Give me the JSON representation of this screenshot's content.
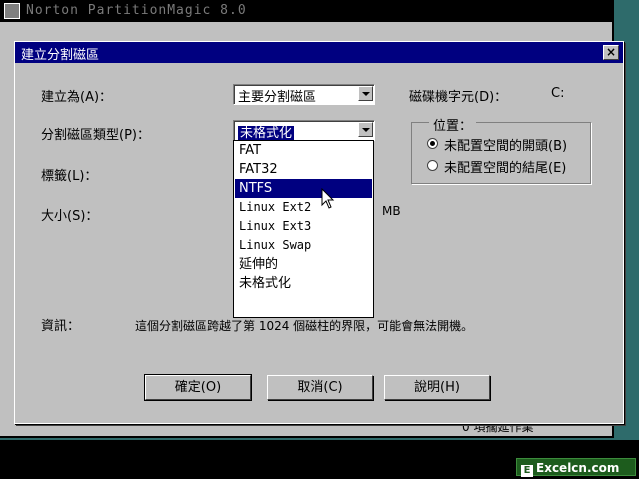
{
  "background_window": {
    "title": "Norton PartitionMagic 8.0",
    "status_text": "0 項擱延作業"
  },
  "dialog": {
    "title": "建立分割磁區",
    "close_label": "×"
  },
  "form": {
    "create_as_label": "建立為(A)：",
    "create_as_value": "主要分割磁區",
    "drive_letter_label": "磁碟機字元(D)：",
    "drive_letter_value": "C:",
    "fs_type_label": "分割磁區類型(P)：",
    "fs_type_value": "未格式化",
    "label_label": "標籤(L)：",
    "size_label": "大小(S)：",
    "size_unit": "MB"
  },
  "position_group": {
    "legend": "位置：",
    "options": [
      {
        "label": "未配置空間的開頭(B)",
        "checked": true
      },
      {
        "label": "未配置空間的結尾(E)",
        "checked": false
      }
    ]
  },
  "dropdown": {
    "items": [
      "FAT",
      "FAT32",
      "NTFS",
      "Linux Ext2",
      "Linux Ext3",
      "Linux Swap",
      "延伸的",
      "未格式化"
    ],
    "highlighted": "NTFS"
  },
  "info": {
    "label": "資訊：",
    "text": "這個分割磁區跨越了第 1024 個磁柱的界限，可能會無法開機。"
  },
  "buttons": {
    "ok": "確定(O)",
    "cancel": "取消(C)",
    "help": "說明(H)"
  },
  "watermark": {
    "text": "Excelcn.com"
  }
}
